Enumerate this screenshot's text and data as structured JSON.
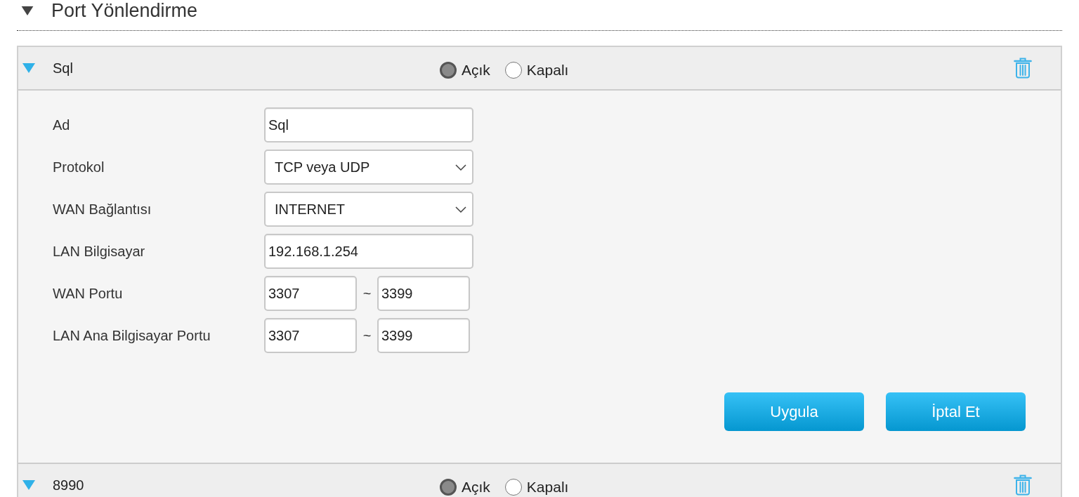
{
  "section": {
    "title": "Port Yönlendirme",
    "expanded": true
  },
  "rules": [
    {
      "name": "Sql",
      "expanded": true,
      "options": [
        {
          "label": "Açık",
          "selected": true
        },
        {
          "label": "Kapalı",
          "selected": false
        }
      ],
      "form": {
        "fields": [
          {
            "kind": "text",
            "label": "Ad",
            "value": "Sql"
          },
          {
            "kind": "select",
            "label": "Protokol",
            "value": "TCP veya UDP"
          },
          {
            "kind": "select",
            "label": "WAN Bağlantısı",
            "value": "INTERNET"
          },
          {
            "kind": "text",
            "label": "LAN Bilgisayar",
            "value": "192.168.1.254"
          },
          {
            "kind": "range",
            "label": "WAN Portu",
            "from": "3307",
            "separator": "~",
            "to": "3399"
          },
          {
            "kind": "range",
            "label": "LAN Ana Bilgisayar Portu",
            "from": "3307",
            "separator": "~",
            "to": "3399"
          }
        ],
        "buttons": [
          "Uygula",
          "İptal Et"
        ]
      }
    },
    {
      "name": "8990",
      "expanded": true,
      "options": [
        {
          "label": "Açık",
          "selected": true
        },
        {
          "label": "Kapalı",
          "selected": false
        }
      ]
    }
  ]
}
